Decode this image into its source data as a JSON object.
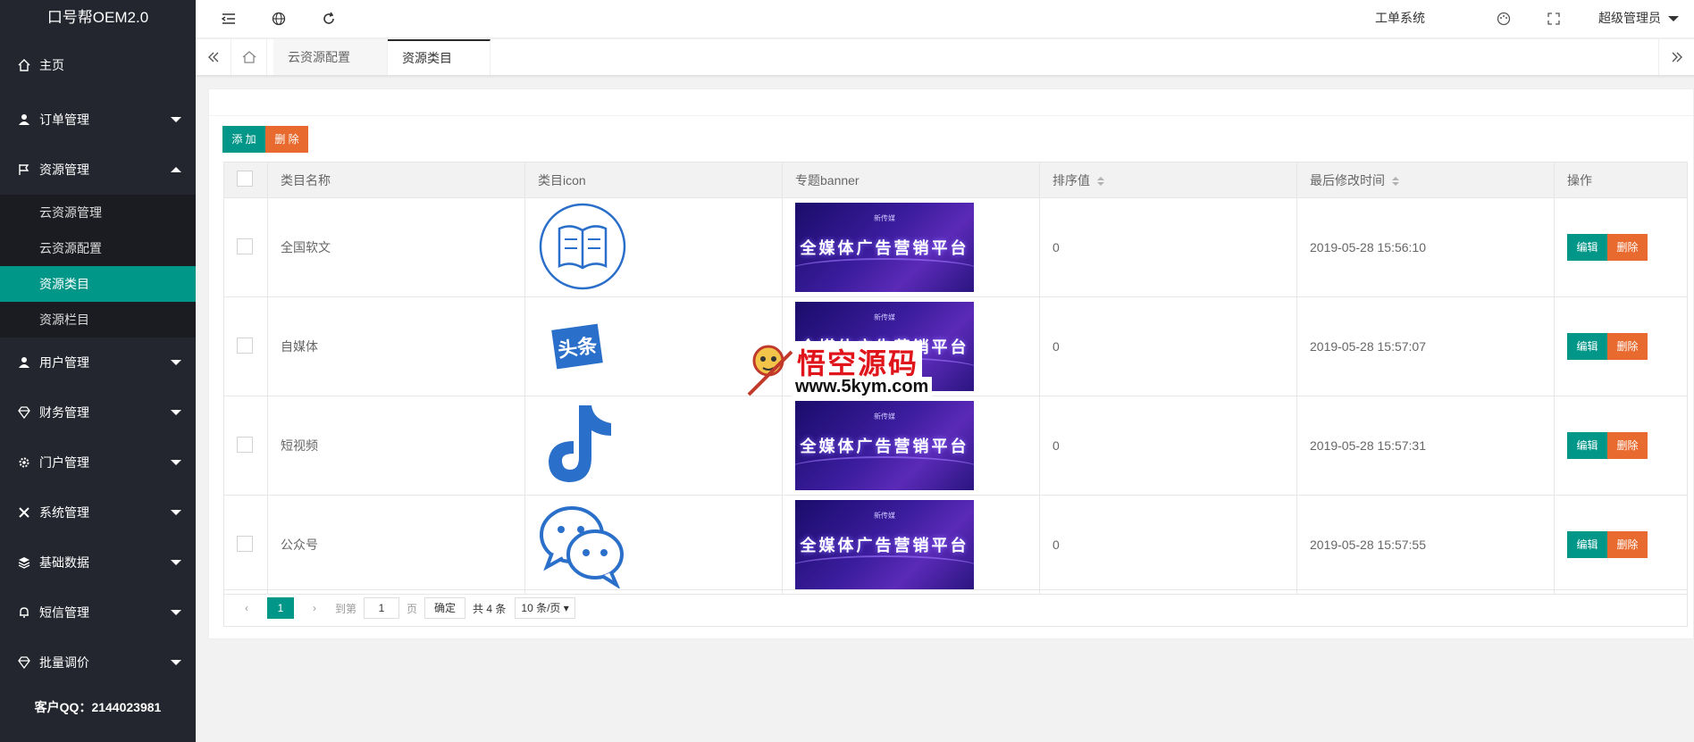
{
  "app": {
    "logo": "口号帮OEM2.0",
    "qq": "客户QQ：2144023981"
  },
  "sidebar": {
    "items": [
      {
        "label": "主页",
        "icon": "home-icon"
      },
      {
        "label": "订单管理",
        "icon": "user-icon"
      },
      {
        "label": "资源管理",
        "icon": "flag-icon"
      },
      {
        "label": "用户管理",
        "icon": "user-icon"
      },
      {
        "label": "财务管理",
        "icon": "diamond-icon"
      },
      {
        "label": "门户管理",
        "icon": "gear-icon"
      },
      {
        "label": "系统管理",
        "icon": "tools-icon"
      },
      {
        "label": "基础数据",
        "icon": "layers-icon"
      },
      {
        "label": "短信管理",
        "icon": "bell-icon"
      },
      {
        "label": "批量调价",
        "icon": "diamond-icon"
      }
    ],
    "sub_items": [
      "云资源管理",
      "云资源配置",
      "资源类目",
      "资源栏目"
    ]
  },
  "header": {
    "system": "工单系统",
    "user": "超级管理员"
  },
  "tabs": [
    {
      "label": "云资源配置"
    },
    {
      "label": "资源类目"
    }
  ],
  "toolbar": {
    "add": "添 加",
    "delete": "删 除"
  },
  "table": {
    "headers": [
      "类目名称",
      "类目icon",
      "专题banner",
      "排序值",
      "最后修改时间",
      "操作"
    ],
    "rows": [
      {
        "name": "全国软文",
        "icon": "book-icon",
        "sort": "0",
        "time": "2019-05-28 15:56:10"
      },
      {
        "name": "自媒体",
        "icon": "toutiao-icon",
        "sort": "0",
        "time": "2019-05-28 15:57:07"
      },
      {
        "name": "短视频",
        "icon": "tiktok-icon",
        "sort": "0",
        "time": "2019-05-28 15:57:31"
      },
      {
        "name": "公众号",
        "icon": "wechat-icon",
        "sort": "0",
        "time": "2019-05-28 15:57:55"
      }
    ],
    "edit_label": "编辑",
    "delete_label": "删除",
    "banner_title": "全媒体广告营销平台",
    "banner_sub": "新传媒",
    "toutiao_text": "头条"
  },
  "pager": {
    "page": "1",
    "goto": "到第",
    "input": "1",
    "unit": "页",
    "ok": "确定",
    "total": "共 4 条",
    "size": "10 条/页"
  },
  "watermark": {
    "title": "悟空源码",
    "url": "www.5kym.com"
  },
  "colors": {
    "accent": "#009688",
    "danger": "#e86a2e",
    "sidebar": "#23262e"
  }
}
